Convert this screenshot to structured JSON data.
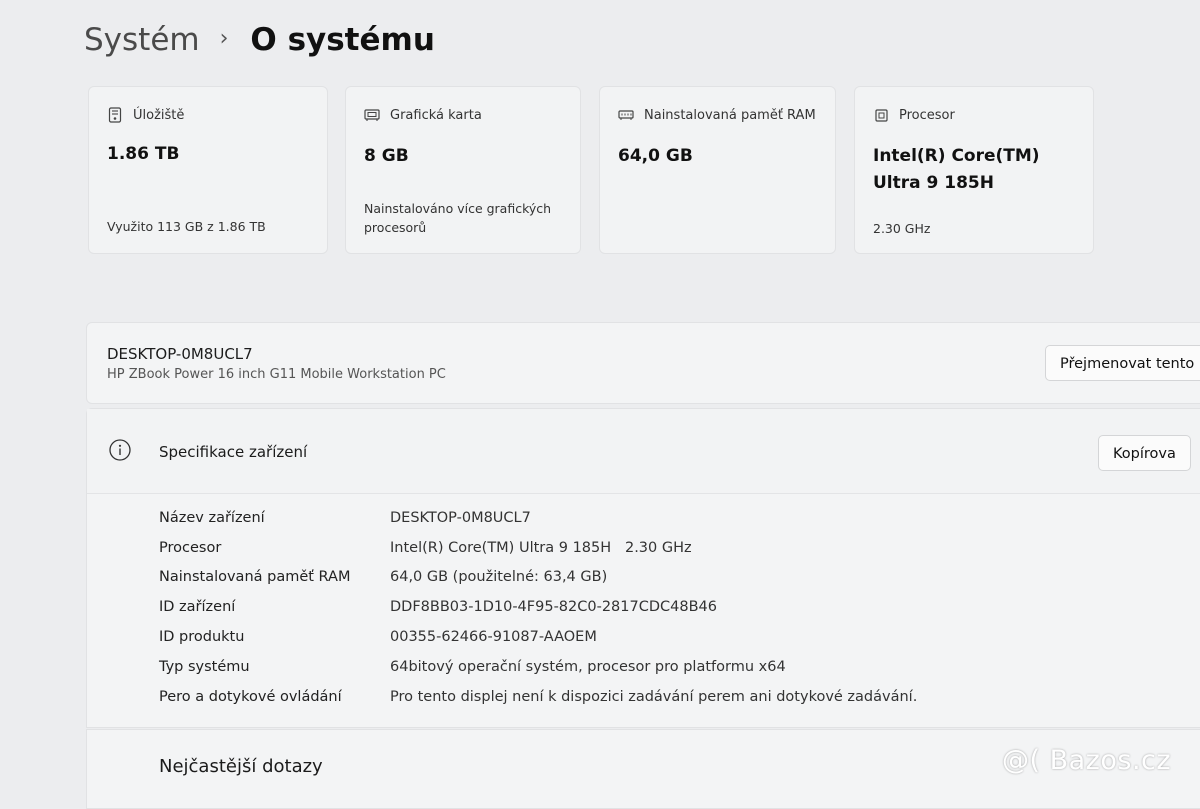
{
  "breadcrumb": {
    "parent": "Systém",
    "separator": "›",
    "current": "O systému"
  },
  "cards": [
    {
      "icon": "storage-icon",
      "title": "Úložiště",
      "value": "1.86 TB",
      "sub": "Využito 113 GB z 1.86 TB"
    },
    {
      "icon": "gpu-icon",
      "title": "Grafická karta",
      "value": "8 GB",
      "sub": "Nainstalováno více grafických procesorů"
    },
    {
      "icon": "ram-icon",
      "title": "Nainstalovaná paměť RAM",
      "value": "64,0 GB",
      "sub": ""
    },
    {
      "icon": "processor-icon",
      "title": "Procesor",
      "value": "Intel(R) Core(TM) Ultra 9 185H",
      "sub": "2.30 GHz"
    }
  ],
  "device": {
    "name": "DESKTOP-0M8UCL7",
    "model": "HP ZBook Power 16 inch G11 Mobile Workstation PC",
    "rename_label": "Přejmenovat tento"
  },
  "specs": {
    "title": "Specifikace zařízení",
    "copy_label": "Kopírova",
    "rows": [
      {
        "label": "Název zařízení",
        "value": "DESKTOP-0M8UCL7"
      },
      {
        "label": "Procesor",
        "value": "Intel(R) Core(TM) Ultra 9 185H   2.30 GHz"
      },
      {
        "label": "Nainstalovaná paměť RAM",
        "value": "64,0 GB (použitelné: 63,4 GB)"
      },
      {
        "label": "ID zařízení",
        "value": "DDF8BB03-1D10-4F95-82C0-2817CDC48B46"
      },
      {
        "label": "ID produktu",
        "value": "00355-62466-91087-AAOEM"
      },
      {
        "label": "Typ systému",
        "value": "64bitový operační systém, procesor pro platformu x64"
      },
      {
        "label": "Pero a dotykové ovládání",
        "value": "Pro tento displej není k dispozici zadávání perem ani dotykové zadávání."
      }
    ]
  },
  "faq": {
    "title": "Nejčastější dotazy"
  },
  "watermark": "@( Bazos.cz"
}
